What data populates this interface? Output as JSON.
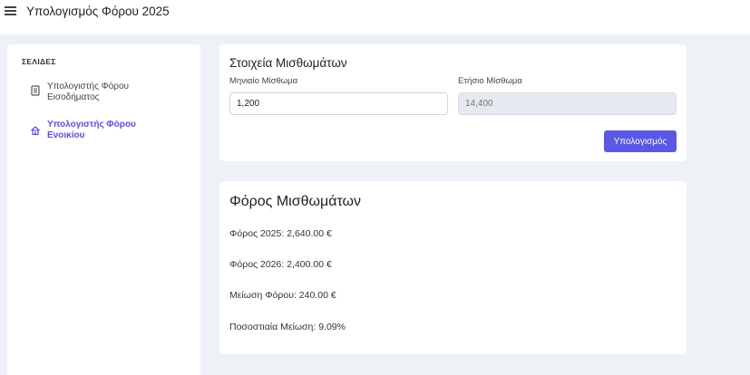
{
  "header": {
    "title": "Υπολογισμός Φόρου 2025",
    "menu_icon": "hamburger-menu-icon"
  },
  "sidebar": {
    "heading": "ΣΕΛΙΔΕΣ",
    "items": [
      {
        "label": "Υπολογιστής Φόρου Εισοδήματος",
        "icon": "document-icon",
        "active": false
      },
      {
        "label": "Υπολογιστής Φόρου Ενοικίου",
        "icon": "home-icon",
        "active": true
      }
    ]
  },
  "form": {
    "title": "Στοιχεία Μισθωμάτων",
    "monthly_label": "Μηνιαίο Μίσθωμα",
    "monthly_value": "1,200",
    "annual_label": "Ετήσιο Μίσθωμα",
    "annual_value": "14,400",
    "calculate_label": "Υπολογισμός"
  },
  "results": {
    "title": "Φόρος Μισθωμάτων",
    "tax_2025": "Φόρος 2025: 2,640.00 €",
    "tax_2026": "Φόρος 2026: 2,400.00 €",
    "reduction": "Μείωση Φόρου: 240.00 €",
    "percent_reduction": "Ποσοστιαία Μείωση: 9.09%"
  },
  "colors": {
    "accent": "#5b57e6",
    "background": "#eef1f6",
    "card": "#ffffff"
  }
}
